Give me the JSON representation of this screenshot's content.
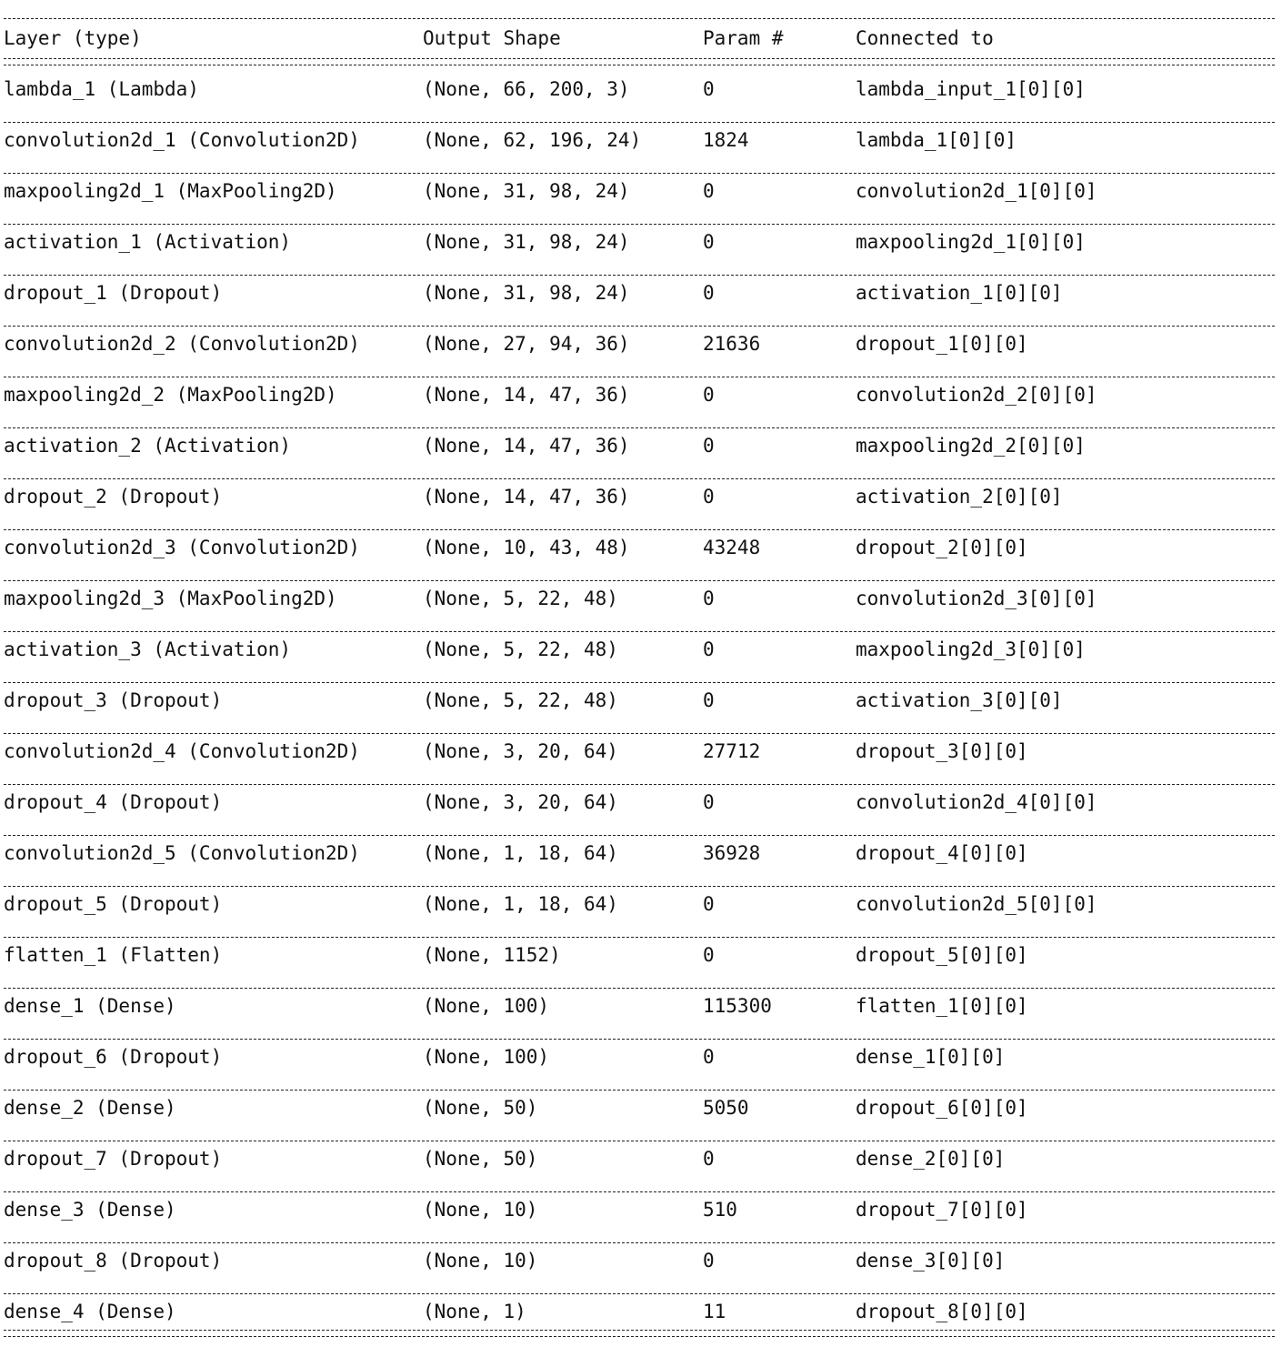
{
  "header": {
    "layer": "Layer (type)",
    "output_shape": "Output Shape",
    "param": "Param #",
    "connected_to": "Connected to"
  },
  "rows": [
    {
      "layer": "lambda_1 (Lambda)",
      "shape": "(None, 66, 200, 3)",
      "params": "0",
      "connected": "lambda_input_1[0][0]"
    },
    {
      "layer": "convolution2d_1 (Convolution2D)",
      "shape": "(None, 62, 196, 24)",
      "params": "1824",
      "connected": "lambda_1[0][0]"
    },
    {
      "layer": "maxpooling2d_1 (MaxPooling2D)",
      "shape": "(None, 31, 98, 24)",
      "params": "0",
      "connected": "convolution2d_1[0][0]"
    },
    {
      "layer": "activation_1 (Activation)",
      "shape": "(None, 31, 98, 24)",
      "params": "0",
      "connected": "maxpooling2d_1[0][0]"
    },
    {
      "layer": "dropout_1 (Dropout)",
      "shape": "(None, 31, 98, 24)",
      "params": "0",
      "connected": "activation_1[0][0]"
    },
    {
      "layer": "convolution2d_2 (Convolution2D)",
      "shape": "(None, 27, 94, 36)",
      "params": "21636",
      "connected": "dropout_1[0][0]"
    },
    {
      "layer": "maxpooling2d_2 (MaxPooling2D)",
      "shape": "(None, 14, 47, 36)",
      "params": "0",
      "connected": "convolution2d_2[0][0]"
    },
    {
      "layer": "activation_2 (Activation)",
      "shape": "(None, 14, 47, 36)",
      "params": "0",
      "connected": "maxpooling2d_2[0][0]"
    },
    {
      "layer": "dropout_2 (Dropout)",
      "shape": "(None, 14, 47, 36)",
      "params": "0",
      "connected": "activation_2[0][0]"
    },
    {
      "layer": "convolution2d_3 (Convolution2D)",
      "shape": "(None, 10, 43, 48)",
      "params": "43248",
      "connected": "dropout_2[0][0]"
    },
    {
      "layer": "maxpooling2d_3 (MaxPooling2D)",
      "shape": "(None, 5, 22, 48)",
      "params": "0",
      "connected": "convolution2d_3[0][0]"
    },
    {
      "layer": "activation_3 (Activation)",
      "shape": "(None, 5, 22, 48)",
      "params": "0",
      "connected": "maxpooling2d_3[0][0]"
    },
    {
      "layer": "dropout_3 (Dropout)",
      "shape": "(None, 5, 22, 48)",
      "params": "0",
      "connected": "activation_3[0][0]"
    },
    {
      "layer": "convolution2d_4 (Convolution2D)",
      "shape": "(None, 3, 20, 64)",
      "params": "27712",
      "connected": "dropout_3[0][0]"
    },
    {
      "layer": "dropout_4 (Dropout)",
      "shape": "(None, 3, 20, 64)",
      "params": "0",
      "connected": "convolution2d_4[0][0]"
    },
    {
      "layer": "convolution2d_5 (Convolution2D)",
      "shape": "(None, 1, 18, 64)",
      "params": "36928",
      "connected": "dropout_4[0][0]"
    },
    {
      "layer": "dropout_5 (Dropout)",
      "shape": "(None, 1, 18, 64)",
      "params": "0",
      "connected": "convolution2d_5[0][0]"
    },
    {
      "layer": "flatten_1 (Flatten)",
      "shape": "(None, 1152)",
      "params": "0",
      "connected": "dropout_5[0][0]"
    },
    {
      "layer": "dense_1 (Dense)",
      "shape": "(None, 100)",
      "params": "115300",
      "connected": "flatten_1[0][0]"
    },
    {
      "layer": "dropout_6 (Dropout)",
      "shape": "(None, 100)",
      "params": "0",
      "connected": "dense_1[0][0]"
    },
    {
      "layer": "dense_2 (Dense)",
      "shape": "(None, 50)",
      "params": "5050",
      "connected": "dropout_6[0][0]"
    },
    {
      "layer": "dropout_7 (Dropout)",
      "shape": "(None, 50)",
      "params": "0",
      "connected": "dense_2[0][0]"
    },
    {
      "layer": "dense_3 (Dense)",
      "shape": "(None, 10)",
      "params": "510",
      "connected": "dropout_7[0][0]"
    },
    {
      "layer": "dropout_8 (Dropout)",
      "shape": "(None, 10)",
      "params": "0",
      "connected": "dense_3[0][0]"
    },
    {
      "layer": "dense_4 (Dense)",
      "shape": "(None, 1)",
      "params": "11",
      "connected": "dropout_8[0][0]"
    }
  ]
}
